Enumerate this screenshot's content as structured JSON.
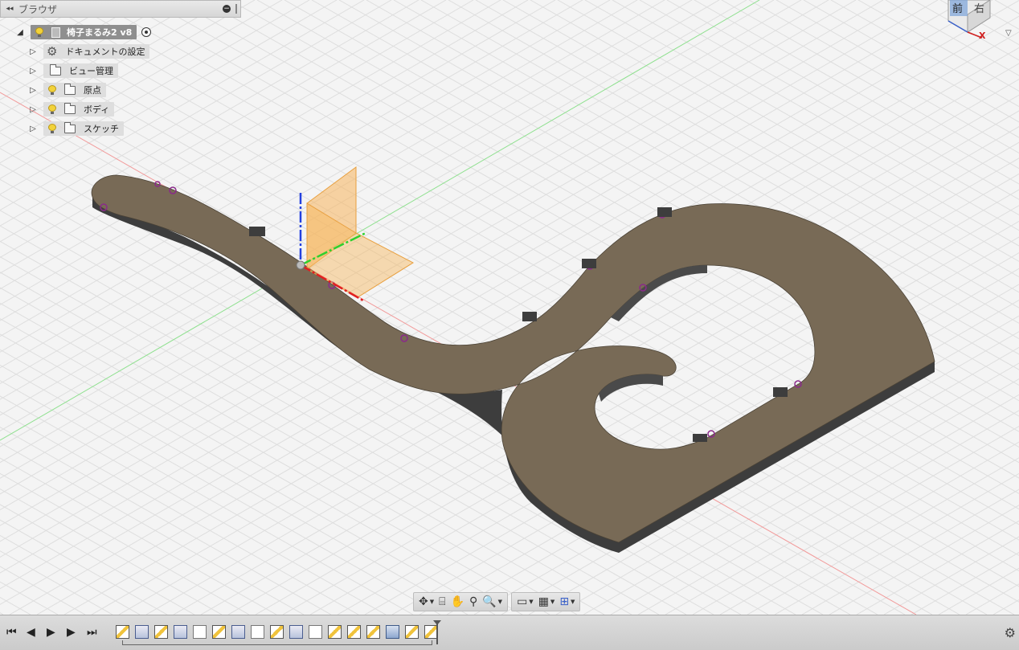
{
  "browser": {
    "title": "ブラウザ",
    "root": {
      "label": "椅子まるみ2 v8"
    },
    "items": [
      {
        "label": "ドキュメントの設定",
        "icon": "gear-icon"
      },
      {
        "label": "ビュー管理",
        "icon": "folder-icon"
      },
      {
        "label": "原点",
        "icon": "folder-icon"
      },
      {
        "label": "ボディ",
        "icon": "folder-icon"
      },
      {
        "label": "スケッチ",
        "icon": "folder-icon"
      }
    ]
  },
  "viewcube": {
    "front": "前",
    "right": "右",
    "axis_x": "X"
  },
  "navbar": {
    "groups": [
      [
        "orbit-icon",
        "look-at-icon",
        "pan-icon",
        "zoom-icon",
        "fit-icon"
      ],
      [
        "display-settings-icon",
        "grid-settings-icon",
        "viewports-icon"
      ]
    ]
  },
  "timeline": {
    "controls": [
      "go-to-start-icon",
      "step-back-icon",
      "play-icon",
      "step-forward-icon",
      "go-to-end-icon"
    ],
    "features": [
      "sketch",
      "extrude",
      "sketch",
      "extrude",
      "fillet",
      "sketch",
      "extrude",
      "fillet",
      "sketch",
      "extrude",
      "fillet",
      "sketch",
      "sketch",
      "sketch",
      "body",
      "sketch",
      "sketch"
    ]
  },
  "colors": {
    "body_top": "#786a56",
    "body_side": "#3e3e3e",
    "plane_orange": "#f7b55c",
    "sketch_magenta": "#8a2a8a",
    "grid": "#d9d9d9"
  }
}
